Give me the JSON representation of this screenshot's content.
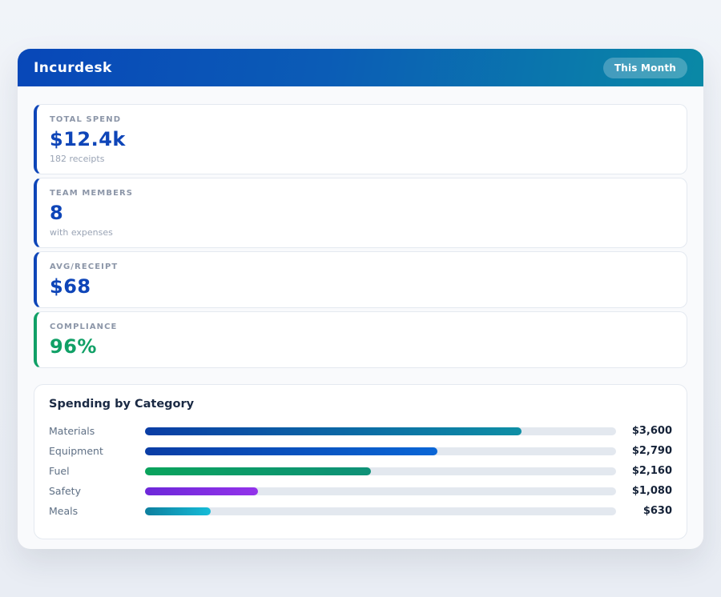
{
  "header": {
    "title": "Incurdesk",
    "period_badge": "This Month",
    "gradient_start": "#0847b8",
    "gradient_end": "#0a89a6"
  },
  "stats": [
    {
      "label": "TOTAL SPEND",
      "value": "$12.4k",
      "sub": "182 receipts",
      "accent": "#0e45b8",
      "value_color": "#0e45b8"
    },
    {
      "label": "TEAM MEMBERS",
      "value": "8",
      "sub": "with expenses",
      "accent": "#0e45b8",
      "value_color": "#0e45b8"
    },
    {
      "label": "AVG/RECEIPT",
      "value": "$68",
      "sub": "",
      "accent": "#0e45b8",
      "value_color": "#0e45b8"
    },
    {
      "label": "COMPLIANCE",
      "value": "96%",
      "sub": "",
      "accent": "#10a066",
      "value_color": "#10a066"
    }
  ],
  "chart": {
    "title": "Spending by Category"
  },
  "chart_data": {
    "type": "bar",
    "orientation": "horizontal",
    "title": "Spending by Category",
    "categories": [
      "Materials",
      "Equipment",
      "Fuel",
      "Safety",
      "Meals"
    ],
    "values": [
      3600,
      2790,
      2160,
      1080,
      630
    ],
    "value_labels": [
      "$3,600",
      "$2,790",
      "$2,160",
      "$1,080",
      "$630"
    ],
    "xlim": [
      0,
      4500
    ],
    "grid": false,
    "legend": false,
    "track_color": "#e3e8ef",
    "bar_colors": [
      {
        "start": "#0a3da5",
        "end": "#0e8fa5"
      },
      {
        "start": "#0a3da5",
        "end": "#0a66d6"
      },
      {
        "start": "#0aa35c",
        "end": "#0f9178"
      },
      {
        "start": "#6d28d9",
        "end": "#9333ea"
      },
      {
        "start": "#0e7f9e",
        "end": "#16bcd8"
      }
    ]
  }
}
